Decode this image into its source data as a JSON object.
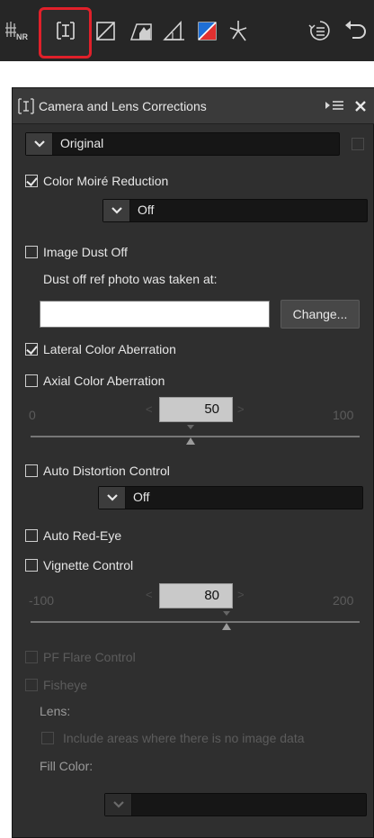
{
  "toolbar": {
    "icons": [
      "noise-reduction-icon",
      "camera-lens-corrections-icon",
      "straighten-icon",
      "perspective-icon",
      "crop-icon",
      "color-balance-icon",
      "sparkle-icon",
      "adjustment-history-icon",
      "undo-icon"
    ],
    "active_icon": "camera-lens-corrections-icon",
    "highlight_color": "#e0202a"
  },
  "palette": {
    "title": "Camera and Lens Corrections",
    "menu_icon": "palette-menu-icon",
    "close_icon": "close-icon"
  },
  "preset": {
    "value": "Original",
    "enabled": false
  },
  "color_moire": {
    "label": "Color Moiré Reduction",
    "checked": true,
    "value": "Off"
  },
  "dust_off": {
    "label": "Image Dust Off",
    "checked": false,
    "ref_label": "Dust off ref photo was taken at:",
    "ref_value": "",
    "change_label": "Change..."
  },
  "lateral_ca": {
    "label": "Lateral Color Aberration",
    "checked": true
  },
  "axial_ca": {
    "label": "Axial Color Aberration",
    "checked": false,
    "min": "0",
    "max": "100",
    "value": "50"
  },
  "distortion": {
    "label": "Auto Distortion Control",
    "checked": false,
    "value": "Off"
  },
  "red_eye": {
    "label": "Auto Red-Eye",
    "checked": false
  },
  "vignette": {
    "label": "Vignette Control",
    "checked": false,
    "min": "-100",
    "max": "200",
    "value": "80"
  },
  "pf_flare": {
    "label": "PF Flare Control",
    "checked": false,
    "enabled": false
  },
  "fisheye": {
    "label": "Fisheye",
    "checked": false,
    "enabled": false,
    "lens_label": "Lens:",
    "include_label": "Include areas where there is no image data",
    "fill_label": "Fill Color:"
  }
}
